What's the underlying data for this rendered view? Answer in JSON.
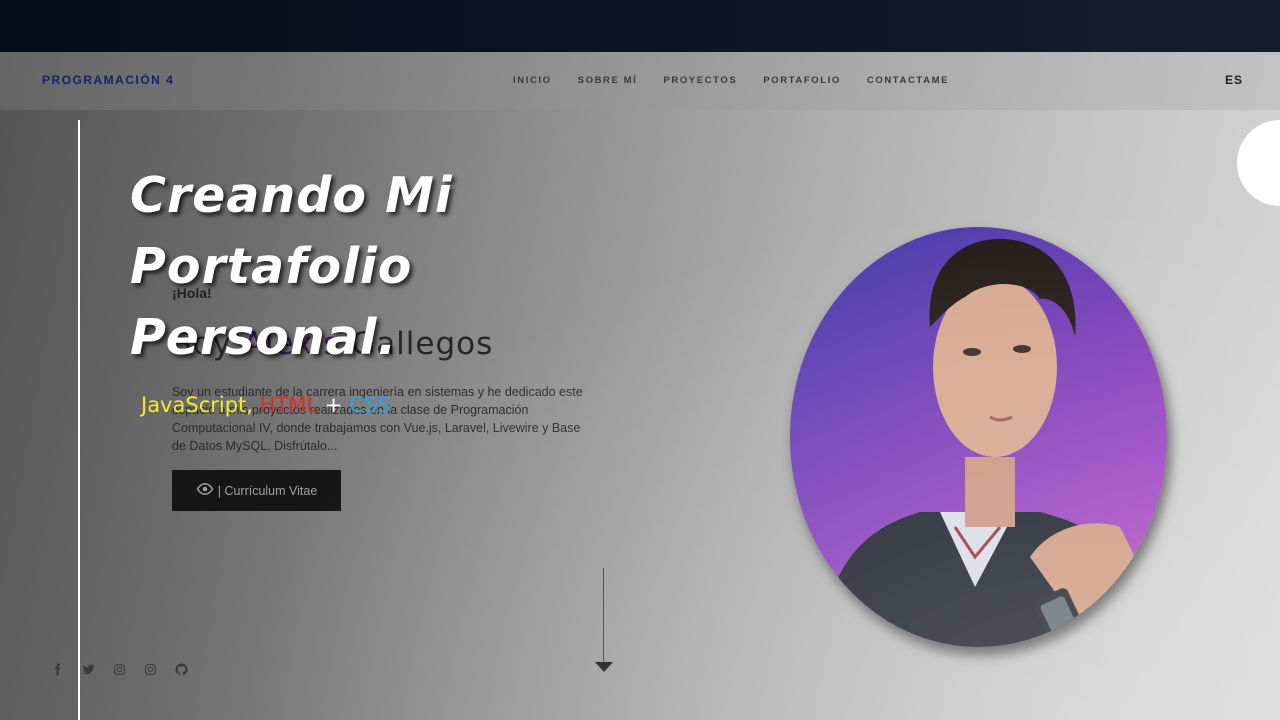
{
  "nav": {
    "brand": "PROGRAMACIÓN 4",
    "items": [
      "INICIO",
      "SOBRE MÍ",
      "PROYECTOS",
      "PORTAFOLIO",
      "CONTACTAME"
    ],
    "lang": "ES"
  },
  "hero": {
    "greeting": "¡Hola!",
    "name_prefix": "Soy ",
    "name_highlight": "Alexis",
    "name_suffix": " Gallegos",
    "description": "Soy un estudiante de la carrera ingeniería en sistemas y he dedicado este espacio a mis proyectos realizados en la clase de Programación Computacional IV, donde trabajamos con Vue.js, Laravel, Livewire y Base de Datos MySQL. Disfrútalo...",
    "cv_button": "| Currículum Vitae"
  },
  "overlay": {
    "title_line1": "Creando Mi",
    "title_line2": "Portafolio",
    "title_line3": "Personal.",
    "tech_js": "JavaScript",
    "tech_sep": ",",
    "tech_html": "HTML",
    "tech_plus": "+",
    "tech_css": "CSS"
  },
  "socials": [
    "facebook-icon",
    "twitter-icon",
    "instagram-icon",
    "instagram-icon",
    "github-icon"
  ],
  "colors": {
    "brand": "#1a1f6e",
    "name_highlight": "#3f1f55",
    "js": "#f4ea2c",
    "html": "#e4281f",
    "css": "#2aa6e0"
  }
}
